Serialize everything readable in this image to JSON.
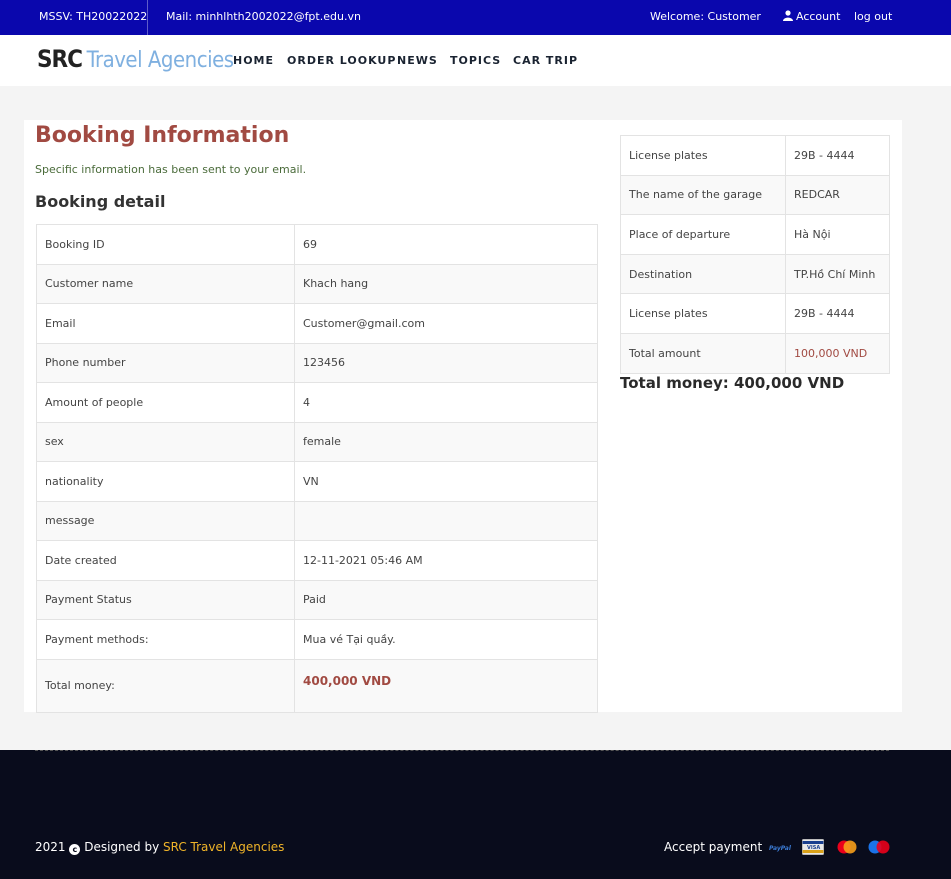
{
  "topbar": {
    "mssv": "MSSV: TH20022022",
    "mail": "Mail: minhlhth2002022@fpt.edu.vn",
    "welcome": "Welcome: Customer",
    "account": "Account",
    "logout": "log out"
  },
  "logo": {
    "part1": "SRC",
    "part2": "Travel Agencies"
  },
  "nav": [
    "HOME",
    "ORDER LOOKUP",
    "NEWS",
    "TOPICS",
    "CAR TRIP"
  ],
  "booking": {
    "title": "Booking Information",
    "note": "Specific information has been sent to your email.",
    "section": "Booking detail",
    "rows": [
      {
        "label": "Booking ID",
        "value": "69"
      },
      {
        "label": "Customer name",
        "value": "Khach hang"
      },
      {
        "label": "Email",
        "value": "Customer@gmail.com"
      },
      {
        "label": "Phone number",
        "value": "123456"
      },
      {
        "label": "Amount of people",
        "value": "4"
      },
      {
        "label": "sex",
        "value": "female"
      },
      {
        "label": "nationality",
        "value": "VN"
      },
      {
        "label": "message",
        "value": ""
      },
      {
        "label": "Date created",
        "value": "12-11-2021 05:46 AM"
      },
      {
        "label": "Payment Status",
        "value": "Paid"
      },
      {
        "label": "Payment methods:",
        "value": "Mua vé Tại quầy."
      },
      {
        "label": "Total money:",
        "value": "400,000 VND"
      }
    ]
  },
  "trip": {
    "rows": [
      {
        "label": "License plates",
        "value": "29B - 4444"
      },
      {
        "label": "The name of the garage",
        "value": "REDCAR"
      },
      {
        "label": "Place of departure",
        "value": "Hà Nội"
      },
      {
        "label": "Destination",
        "value": "TP.Hồ Chí Minh"
      },
      {
        "label": "License plates",
        "value": "29B - 4444"
      },
      {
        "label": "Total amount",
        "value": "100,000 VND"
      }
    ],
    "total": "Total money: 400,000 VND"
  },
  "footer": {
    "year": "2021",
    "designed": "Designed by",
    "brand": "SRC Travel Agencies",
    "accept": "Accept payment",
    "methods": [
      "paypal-icon",
      "visa-icon",
      "mastercard-icon",
      "maestro-icon"
    ]
  },
  "colors": {
    "topbar": "#0a07ad",
    "accent": "#a14a42",
    "footer": "#090c1c",
    "brand": "#f0b429"
  }
}
